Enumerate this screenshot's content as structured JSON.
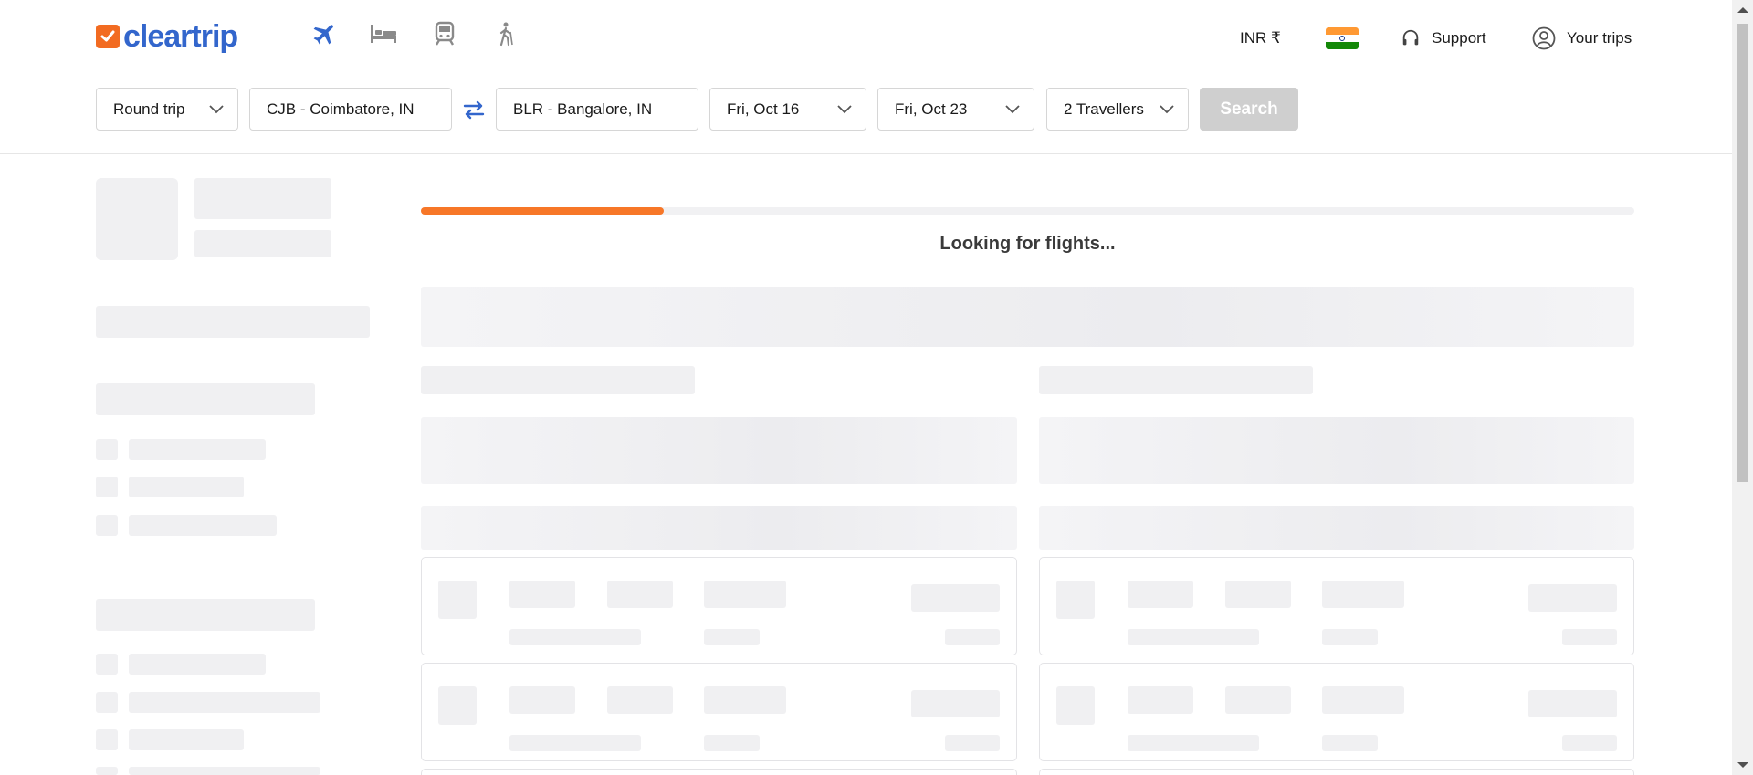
{
  "brand": {
    "name": "cleartrip",
    "accent": "#f26b21",
    "text_color": "#3366cc"
  },
  "nav": {
    "categories": [
      {
        "name": "flights",
        "icon": "airplane-icon",
        "active": true
      },
      {
        "name": "hotels",
        "icon": "bed-icon",
        "active": false
      },
      {
        "name": "trains",
        "icon": "train-icon",
        "active": false
      },
      {
        "name": "activities",
        "icon": "hiking-icon",
        "active": false
      }
    ],
    "currency_label": "INR ₹",
    "support_label": "Support",
    "trips_label": "Your trips",
    "flag_colors": [
      "#ff9933",
      "#ffffff",
      "#138808"
    ]
  },
  "search": {
    "trip_type": "Round trip",
    "from": "CJB - Coimbatore, IN",
    "to": "BLR - Bangalore, IN",
    "depart": "Fri, Oct 16",
    "return": "Fri, Oct 23",
    "travellers": "2 Travellers",
    "button_label": "Search"
  },
  "results": {
    "status_text": "Looking for flights...",
    "progress": 0.2,
    "progress_color": "#f77728"
  }
}
